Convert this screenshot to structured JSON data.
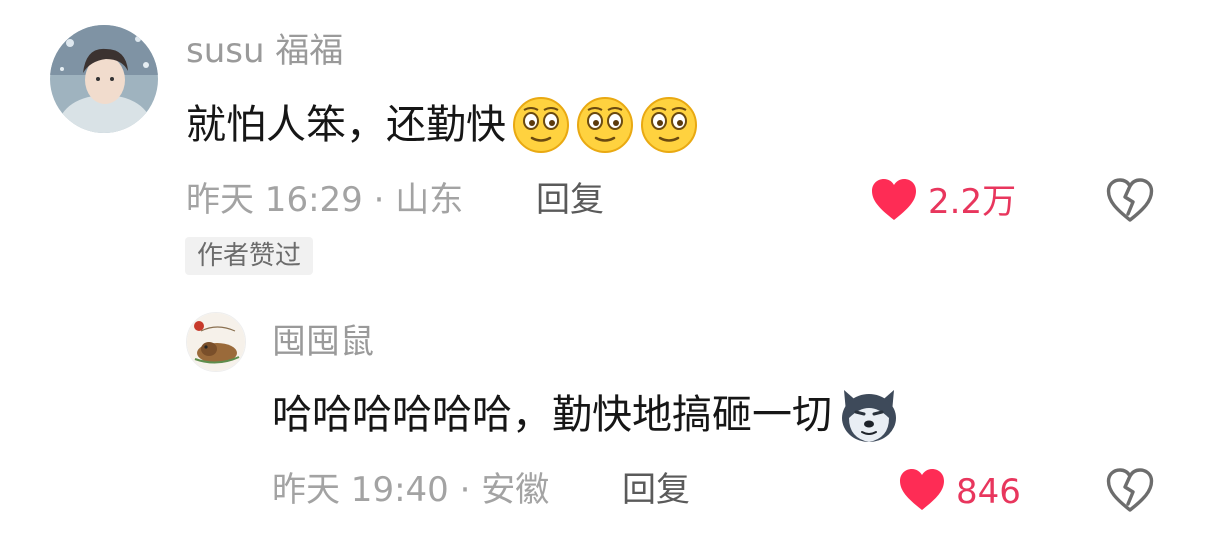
{
  "comment": {
    "username": "susu 福福",
    "text": "就怕人笨，还勤快",
    "emojis": [
      "smirk-face-emoji",
      "smirk-face-emoji",
      "smirk-face-emoji"
    ],
    "time_location": "昨天 16:29 · 山东",
    "reply_label": "回复",
    "like_count": "2.2万",
    "liked": true,
    "badge": "作者赞过"
  },
  "reply": {
    "username": "囤囤鼠",
    "text": "哈哈哈哈哈哈，勤快地搞砸一切",
    "emoji": "husky-dog-emoji",
    "time_location": "昨天 19:40 · 安徽",
    "reply_label": "回复",
    "like_count": "846",
    "liked": true
  },
  "colors": {
    "like_red": "#fe2c55",
    "count_red": "#e8365d",
    "meta_gray": "#a3a3a3",
    "text_dark": "#161616"
  }
}
